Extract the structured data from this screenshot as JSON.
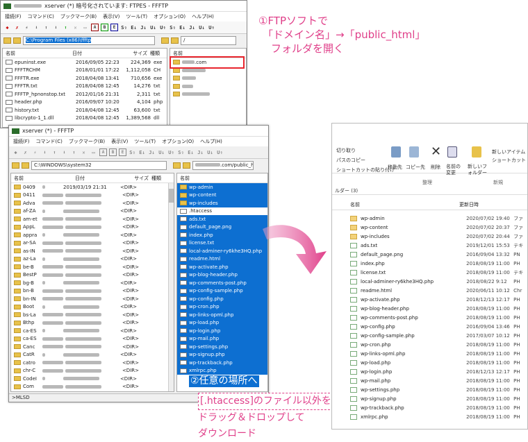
{
  "win1": {
    "title": "xserver (*) 暗号化されています: FTPES - FFFTP",
    "menus": [
      "接続(F)",
      "コマンド(C)",
      "ブックマーク(B)",
      "表示(V)",
      "ツール(T)",
      "オプション(O)",
      "ヘルプ(H)"
    ],
    "toolbar": [
      "S⇧",
      "E↓",
      "J↓",
      "U↓",
      "U⇑",
      "S⇧",
      "E↓",
      "J↓",
      "U↓",
      "U⇑"
    ],
    "local_path": "C:\\Program Files (x86)\\ffftp",
    "remote_path": "/",
    "local_headers": [
      "名前",
      "日付",
      "サイズ",
      "種類"
    ],
    "remote_headers": [
      "名前"
    ],
    "local_files": [
      {
        "name": "epuninst.exe",
        "date": "2016/09/05 22:23",
        "size": "224,369",
        "type": "exe"
      },
      {
        "name": "FFFTRCHM",
        "date": "2018/01/01 17:22",
        "size": "1,112,058",
        "type": "CH"
      },
      {
        "name": "FFFTR.exe",
        "date": "2018/04/08 13:41",
        "size": "710,656",
        "type": "exe"
      },
      {
        "name": "FFFTR.txt",
        "date": "2018/04/08 12:45",
        "size": "14,276",
        "type": "txt"
      },
      {
        "name": "FFFTP_hpnonstop.txt",
        "date": "2012/01/16 21:31",
        "size": "2,311",
        "type": "txt"
      },
      {
        "name": "header.php",
        "date": "2016/09/07 10:20",
        "size": "4,104",
        "type": "php"
      },
      {
        "name": "history.txt",
        "date": "2018/04/08 12:45",
        "size": "63,600",
        "type": "txt"
      },
      {
        "name": "libcrypto-1_1.dll",
        "date": "2018/04/08 12:45",
        "size": "1,389,568",
        "type": "dll"
      }
    ],
    "remote_first": ".com"
  },
  "annot1": {
    "line1": "①FTPソフトで",
    "line2": "「ドメイン名」→「public_html」",
    "line3": "フォルダを開く"
  },
  "win2": {
    "title": "xserver (*) - FFFTP",
    "menus": [
      "接続(F)",
      "コマンド(C)",
      "ブックマーク(B)",
      "表示(V)",
      "ツール(T)",
      "オプション(O)",
      "ヘルプ(H)"
    ],
    "local_path": "C:\\WINDOWS\\system32",
    "remote_path": ".com/public_h",
    "local_headers": [
      "名前",
      "日付",
      "サイズ",
      "種類"
    ],
    "remote_headers": [
      "名前"
    ],
    "status": ">MLSD",
    "local_dirs": [
      {
        "name": "0409",
        "date": "2019/03/19 21:31",
        "size": "<DIR>"
      },
      {
        "name": "0411",
        "date": "",
        "size": "<DIR>"
      },
      {
        "name": "Adva",
        "date": "",
        "size": "<DIR>"
      },
      {
        "name": "af-ZA",
        "date": "",
        "size": "<DIR>"
      },
      {
        "name": "am-et",
        "date": "",
        "size": "<DIR>"
      },
      {
        "name": "AppL",
        "date": "",
        "size": "<DIR>"
      },
      {
        "name": "appra",
        "date": "",
        "size": "<DIR>"
      },
      {
        "name": "ar-SA",
        "date": "",
        "size": "<DIR>"
      },
      {
        "name": "as-IN",
        "date": "",
        "size": "<DIR>"
      },
      {
        "name": "az-La",
        "date": "",
        "size": "<DIR>"
      },
      {
        "name": "be-B",
        "date": "",
        "size": "<DIR>"
      },
      {
        "name": "BestP",
        "date": "",
        "size": "<DIR>"
      },
      {
        "name": "bg-B",
        "date": "",
        "size": "<DIR>"
      },
      {
        "name": "bn-B",
        "date": "",
        "size": "<DIR>"
      },
      {
        "name": "bn-IN",
        "date": "",
        "size": "<DIR>"
      },
      {
        "name": "Boot",
        "date": "",
        "size": "<DIR>"
      },
      {
        "name": "bs-La",
        "date": "",
        "size": "<DIR>"
      },
      {
        "name": "Bthp",
        "date": "",
        "size": "<DIR>"
      },
      {
        "name": "ca-ES",
        "date": "",
        "size": "<DIR>"
      },
      {
        "name": "ca-ES",
        "date": "",
        "size": "<DIR>"
      },
      {
        "name": "Canc",
        "date": "",
        "size": "<DIR>"
      },
      {
        "name": "CatR",
        "date": "",
        "size": "<DIR>"
      },
      {
        "name": "catro",
        "date": "",
        "size": "<DIR>"
      },
      {
        "name": "chr-C",
        "date": "",
        "size": "<DIR>"
      },
      {
        "name": "CodeI",
        "date": "",
        "size": "<DIR>"
      },
      {
        "name": "Com",
        "date": "",
        "size": "<DIR>"
      }
    ],
    "remote_files": [
      {
        "name": "wp-admin",
        "kind": "folder",
        "sel": true
      },
      {
        "name": "wp-content",
        "kind": "folder",
        "sel": true
      },
      {
        "name": "wp-includes",
        "kind": "folder",
        "sel": true
      },
      {
        "name": ".htaccess",
        "kind": "file",
        "sel": false
      },
      {
        "name": "ads.txt",
        "kind": "file",
        "sel": true
      },
      {
        "name": "default_page.png",
        "kind": "file",
        "sel": true
      },
      {
        "name": "index.php",
        "kind": "file",
        "sel": true
      },
      {
        "name": "license.txt",
        "kind": "file",
        "sel": true
      },
      {
        "name": "local-adminer-ry6khe3HQ.php",
        "kind": "file",
        "sel": true
      },
      {
        "name": "readme.html",
        "kind": "file",
        "sel": true
      },
      {
        "name": "wp-activate.php",
        "kind": "file",
        "sel": true
      },
      {
        "name": "wp-blog-header.php",
        "kind": "file",
        "sel": true
      },
      {
        "name": "wp-comments-post.php",
        "kind": "file",
        "sel": true
      },
      {
        "name": "wp-config-sample.php",
        "kind": "file",
        "sel": true
      },
      {
        "name": "wp-config.php",
        "kind": "file",
        "sel": true
      },
      {
        "name": "wp-cron.php",
        "kind": "file",
        "sel": true
      },
      {
        "name": "wp-links-opml.php",
        "kind": "file",
        "sel": true
      },
      {
        "name": "wp-load.php",
        "kind": "file",
        "sel": true
      },
      {
        "name": "wp-login.php",
        "kind": "file",
        "sel": true
      },
      {
        "name": "wp-mail.php",
        "kind": "file",
        "sel": true
      },
      {
        "name": "wp-settings.php",
        "kind": "file",
        "sel": true
      },
      {
        "name": "wp-signup.php",
        "kind": "file",
        "sel": true
      },
      {
        "name": "wp-trackback.php",
        "kind": "file",
        "sel": true
      },
      {
        "name": "xmlrpc.php",
        "kind": "file",
        "sel": true
      }
    ]
  },
  "annot2": {
    "line1": "②任意の場所へ",
    "line2": "[.htaccess]のファイル以外を",
    "line3": "ドラッグ＆ドロップして",
    "line4": "ダウンロード"
  },
  "explorer": {
    "ribbon": {
      "cut": "切り取り",
      "copy_path": "パスのコピー",
      "paste_shortcut": "ショートカットの貼り付け",
      "move_to": "移動先",
      "copy_to": "コピー先",
      "delete": "削除",
      "rename": "名前の変更",
      "new_folder": "新しいフォルダー",
      "new_item": "新しいアイテム",
      "shortcut": "ショートカット",
      "group_organize": "整理",
      "group_new": "新規"
    },
    "folder_label": "ルダー (3)",
    "headers": [
      "名前",
      "更新日時"
    ],
    "items": [
      {
        "name": "wp-admin",
        "date": "2020/07/02 19:40",
        "type": "ファ",
        "kind": "folder"
      },
      {
        "name": "wp-content",
        "date": "2020/07/02 20:37",
        "type": "ファ",
        "kind": "folder"
      },
      {
        "name": "wp-includes",
        "date": "2020/07/02 20:44",
        "type": "ファ",
        "kind": "folder"
      },
      {
        "name": "ads.txt",
        "date": "2019/12/01 15:53",
        "type": "テキ",
        "kind": "file"
      },
      {
        "name": "default_page.png",
        "date": "2016/09/04 13:32",
        "type": "PN",
        "kind": "file"
      },
      {
        "name": "index.php",
        "date": "2018/08/19 11:00",
        "type": "PH",
        "kind": "file"
      },
      {
        "name": "license.txt",
        "date": "2018/08/19 11:00",
        "type": "テキ",
        "kind": "file"
      },
      {
        "name": "local-adminer-ry6khe3HQ.php",
        "date": "2018/08/22 9:12",
        "type": "PH",
        "kind": "file"
      },
      {
        "name": "readme.html",
        "date": "2020/06/11 10:12",
        "type": "Chr",
        "kind": "file"
      },
      {
        "name": "wp-activate.php",
        "date": "2018/12/13 12:17",
        "type": "PH",
        "kind": "file"
      },
      {
        "name": "wp-blog-header.php",
        "date": "2018/08/19 11:00",
        "type": "PH",
        "kind": "file"
      },
      {
        "name": "wp-comments-post.php",
        "date": "2018/08/19 11:00",
        "type": "PH",
        "kind": "file"
      },
      {
        "name": "wp-config.php",
        "date": "2016/09/04 13:46",
        "type": "PH",
        "kind": "file"
      },
      {
        "name": "wp-config-sample.php",
        "date": "2017/03/07 10:12",
        "type": "PH",
        "kind": "file"
      },
      {
        "name": "wp-cron.php",
        "date": "2018/08/19 11:00",
        "type": "PH",
        "kind": "file"
      },
      {
        "name": "wp-links-opml.php",
        "date": "2018/08/19 11:00",
        "type": "PH",
        "kind": "file"
      },
      {
        "name": "wp-load.php",
        "date": "2018/08/19 11:00",
        "type": "PH",
        "kind": "file"
      },
      {
        "name": "wp-login.php",
        "date": "2018/12/13 12:17",
        "type": "PH",
        "kind": "file"
      },
      {
        "name": "wp-mail.php",
        "date": "2018/08/19 11:00",
        "type": "PH",
        "kind": "file"
      },
      {
        "name": "wp-settings.php",
        "date": "2018/08/19 11:00",
        "type": "PH",
        "kind": "file"
      },
      {
        "name": "wp-signup.php",
        "date": "2018/08/19 11:00",
        "type": "PH",
        "kind": "file"
      },
      {
        "name": "wp-trackback.php",
        "date": "2018/08/19 11:00",
        "type": "PH",
        "kind": "file"
      },
      {
        "name": "xmlrpc.php",
        "date": "2018/08/19 11:00",
        "type": "PH",
        "kind": "file"
      }
    ]
  },
  "colors": {
    "accent_pink": "#e0408a",
    "selection_blue": "#0d6fd1",
    "highlight_red": "#e8252d"
  }
}
